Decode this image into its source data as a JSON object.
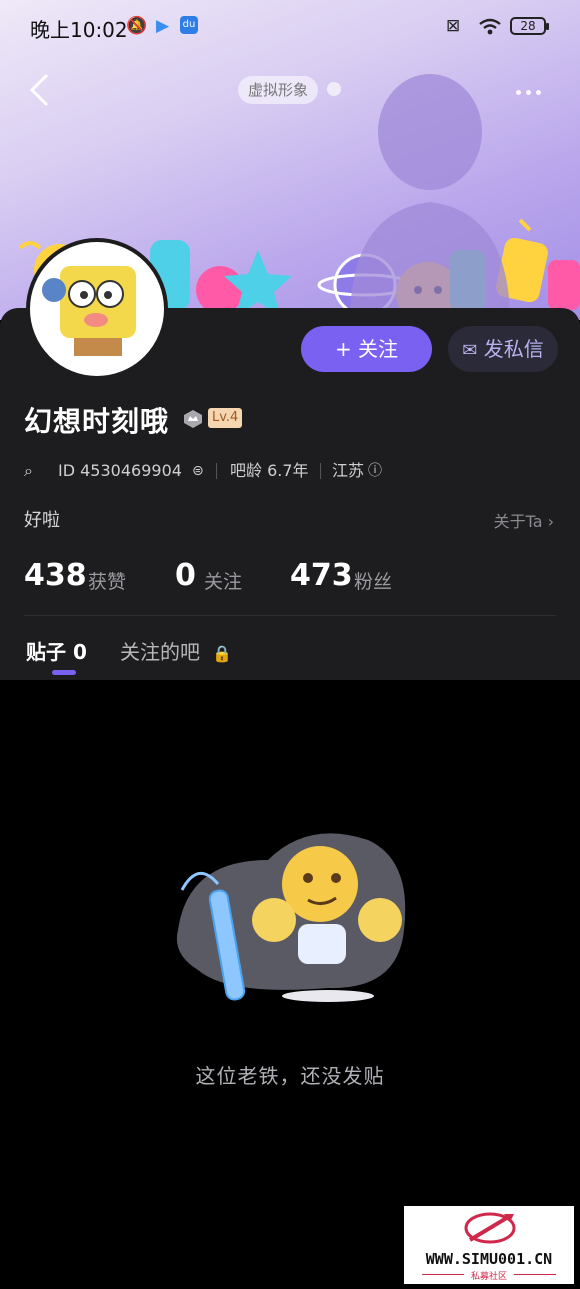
{
  "status_bar": {
    "time": "晚上10:02",
    "battery": "28"
  },
  "header": {
    "virtual_image_label": "虚拟形象"
  },
  "actions": {
    "follow_label": "+ 关注",
    "message_label": "发私信"
  },
  "profile": {
    "username": "幻想时刻哦",
    "level": "Lv.4",
    "id_text": "ID 4530469904",
    "bar_age": "吧龄 6.7年",
    "location": "江苏",
    "bio": "好啦",
    "about_label": "关于Ta"
  },
  "stats": [
    {
      "value": "438",
      "label": "获赞"
    },
    {
      "value": "0",
      "label": "关注"
    },
    {
      "value": "473",
      "label": "粉丝"
    }
  ],
  "tabs": {
    "posts": "贴子 0",
    "followed_bars": "关注的吧"
  },
  "empty_state": {
    "message": "这位老铁，还没发贴"
  },
  "watermark": {
    "url": "WWW.SIMU001.CN",
    "subtitle": "私募社区"
  },
  "colors": {
    "accent": "#7b61f2",
    "card_bg": "#1d1d1f",
    "page_bg": "#000000"
  }
}
